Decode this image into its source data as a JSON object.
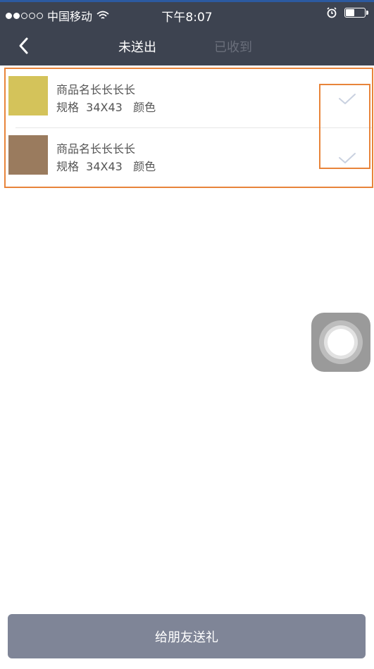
{
  "status_bar": {
    "carrier": "中国移动",
    "time": "下午8:07"
  },
  "nav": {
    "tabs": [
      {
        "label": "未送出",
        "active": true
      },
      {
        "label": "已收到",
        "active": false
      }
    ]
  },
  "items": [
    {
      "name": "商品名长长长长",
      "spec": "规格  34X43   颜色",
      "swatch_color": "#d4c35a"
    },
    {
      "name": "商品名长长长长",
      "spec": "规格  34X43   颜色",
      "swatch_color": "#9a7b5e"
    }
  ],
  "actions": {
    "gift_label": "给朋友送礼"
  },
  "colors": {
    "header_bg": "#3d4350",
    "highlight": "#e8843a",
    "button_bg": "#7f8597"
  },
  "icons": {
    "back": "chevron-left-icon",
    "check": "checkmark-icon",
    "wifi": "wifi-icon",
    "alarm": "alarm-icon"
  }
}
